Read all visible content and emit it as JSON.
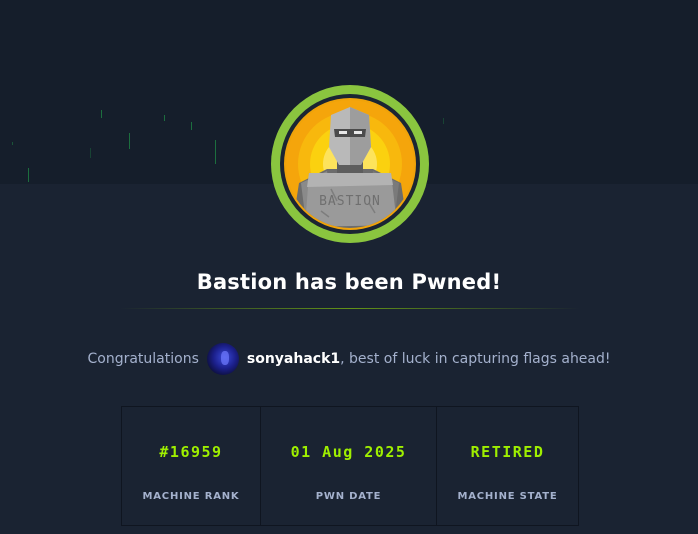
{
  "machine": {
    "badge_icon": "machine-badge-icon",
    "badge_text": "BASTION",
    "title": "Bastion has been Pwned!"
  },
  "congrats": {
    "prefix": "Congratulations",
    "avatar_icon": "user-avatar",
    "username": "sonyahack1",
    "suffix": ", best of luck in capturing flags ahead!"
  },
  "stats": [
    {
      "value": "#16959",
      "label": "MACHINE RANK"
    },
    {
      "value": "01 Aug 2025",
      "label": "PWN DATE"
    },
    {
      "value": "RETIRED",
      "label": "MACHINE STATE"
    }
  ],
  "colors": {
    "background": "#1a2332",
    "banner": "#151e2b",
    "accent": "#9fef00",
    "text_muted": "#a4b1cd",
    "badge_ring": "#8ac53f"
  }
}
